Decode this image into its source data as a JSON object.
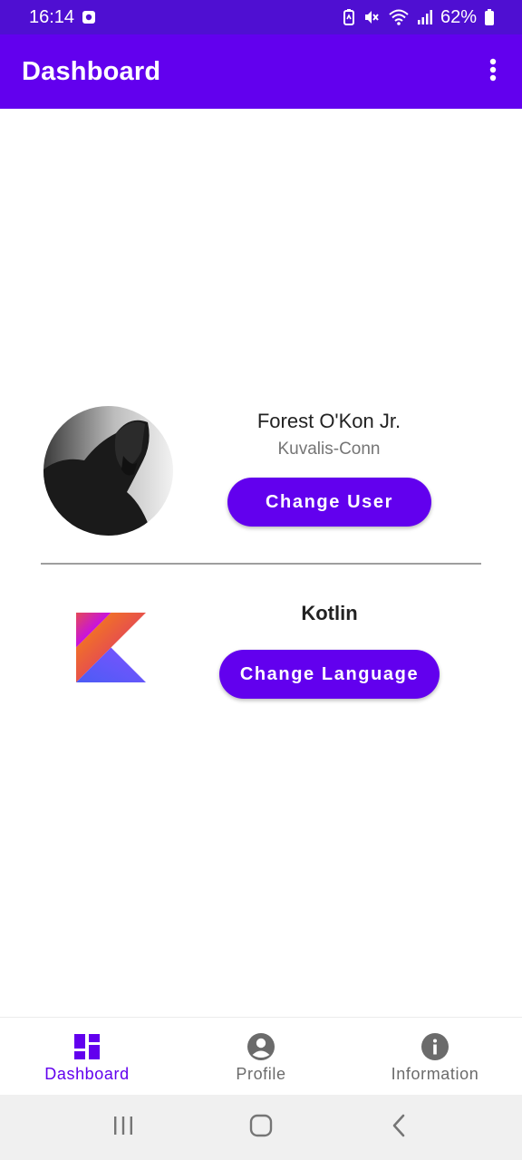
{
  "status_bar": {
    "time": "16:14",
    "battery": "62%",
    "icons": [
      "gallery-notification-icon",
      "battery-saver-icon",
      "mute-icon",
      "wifi-icon",
      "signal-icon",
      "battery-icon"
    ]
  },
  "app_bar": {
    "title": "Dashboard",
    "overflow_icon": "more-vert-icon"
  },
  "user": {
    "name": "Forest O'Kon Jr.",
    "company": "Kuvalis-Conn",
    "change_button": "Change User"
  },
  "language": {
    "name": "Kotlin",
    "change_button": "Change Language"
  },
  "bottom_nav": {
    "items": [
      {
        "label": "Dashboard",
        "icon": "dashboard-icon",
        "active": true
      },
      {
        "label": "Profile",
        "icon": "account-circle-icon",
        "active": false
      },
      {
        "label": "Information",
        "icon": "info-icon",
        "active": false
      }
    ]
  },
  "system_nav": {
    "buttons": [
      "recent-apps-icon",
      "home-icon",
      "back-icon"
    ]
  },
  "colors": {
    "primary": "#6200ee",
    "status_bar": "#4f0fd2",
    "inactive": "#6b6b6b"
  }
}
